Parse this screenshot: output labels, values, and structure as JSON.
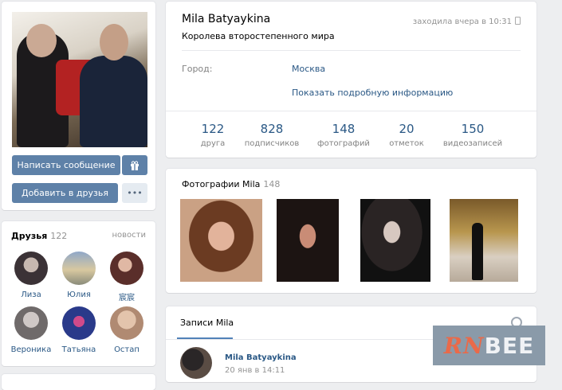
{
  "profile": {
    "name": "Mila Batyaykina",
    "status": "Королева второстепенного мира",
    "last_seen": "заходила вчера в 10:31",
    "city_label": "Город:",
    "city_value": "Москва",
    "more_info": "Показать подробную информацию"
  },
  "actions": {
    "message": "Написать сообщение",
    "add_friend": "Добавить в друзья",
    "more": "•••"
  },
  "counters": [
    {
      "value": "122",
      "label": "друга"
    },
    {
      "value": "828",
      "label": "подписчиков"
    },
    {
      "value": "148",
      "label": "фотографий"
    },
    {
      "value": "20",
      "label": "отметок"
    },
    {
      "value": "150",
      "label": "видеозаписей"
    }
  ],
  "friends": {
    "title": "Друзья",
    "count": "122",
    "link": "новости",
    "items": [
      {
        "name": "Лиза",
        "color": "#3b3236"
      },
      {
        "name": "Юлия",
        "color": "#8a8b7a"
      },
      {
        "name": "宸宸",
        "color": "#5a2e2a"
      },
      {
        "name": "Вероника",
        "color": "#6f6a6a"
      },
      {
        "name": "Татьяна",
        "color": "#2a3a8a"
      },
      {
        "name": "Остап",
        "color": "#b08a72"
      }
    ]
  },
  "photos": {
    "title": "Фотографии Mila",
    "count": "148"
  },
  "posts": {
    "tab": "Записи Mila",
    "author": "Mila Batyaykina",
    "date": "20 янв в 14:11"
  },
  "watermark": {
    "part1": "RN",
    "part2": "BEE"
  },
  "colors": {
    "accent": "#5e81a8",
    "link": "#2a5885",
    "background": "#edeef0"
  }
}
